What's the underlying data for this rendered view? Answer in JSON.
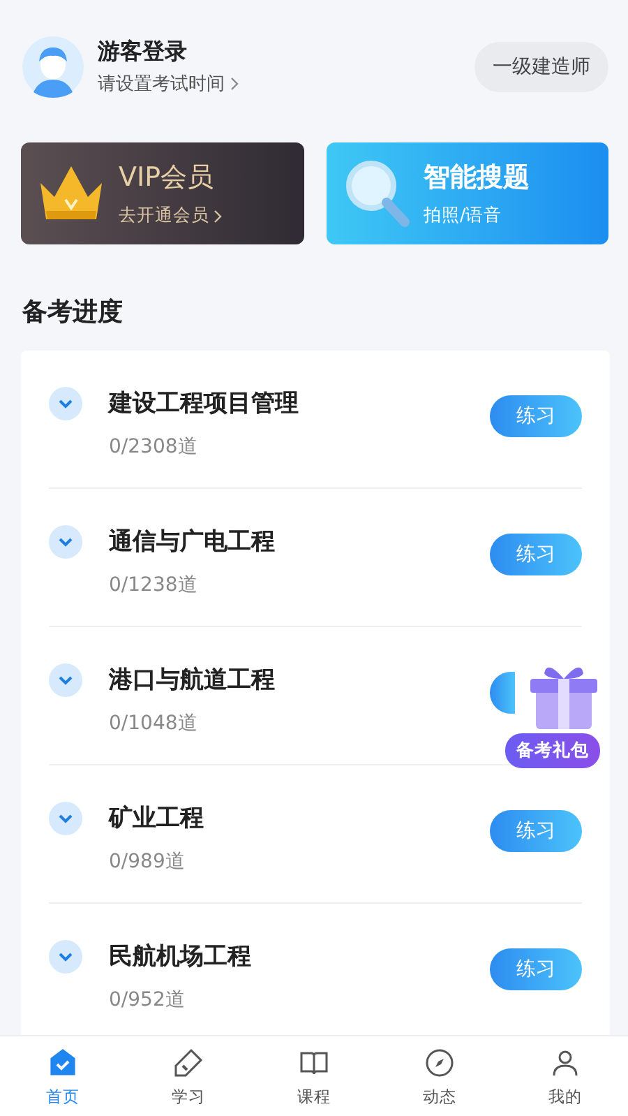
{
  "profile": {
    "name": "游客登录",
    "hint": "请设置考试时间",
    "exam": "一级建造师"
  },
  "promos": [
    {
      "kind": "vip",
      "title": "VIP会员",
      "subtitle": "去开通会员"
    },
    {
      "kind": "search",
      "title": "智能搜题",
      "subtitle": "拍照/语音"
    }
  ],
  "section_title": "备考进度",
  "subjects": [
    {
      "name": "建设工程项目管理",
      "count": "0/2308道",
      "action": "练习"
    },
    {
      "name": "通信与广电工程",
      "count": "0/1238道",
      "action": "练习"
    },
    {
      "name": "港口与航道工程",
      "count": "0/1048道"
    },
    {
      "name": "矿业工程",
      "count": "0/989道",
      "action": "练习"
    },
    {
      "name": "民航机场工程",
      "count": "0/952道",
      "action": "练习"
    }
  ],
  "gift_badge": {
    "label": "备考礼包"
  },
  "tabs": [
    {
      "label": "首页",
      "kind": "home",
      "selected": true
    },
    {
      "label": "学习",
      "kind": "pencil",
      "selected": false
    },
    {
      "label": "课程",
      "kind": "book",
      "selected": false
    },
    {
      "label": "动态",
      "kind": "compass",
      "selected": false
    },
    {
      "label": "我的",
      "kind": "person",
      "selected": false
    }
  ]
}
